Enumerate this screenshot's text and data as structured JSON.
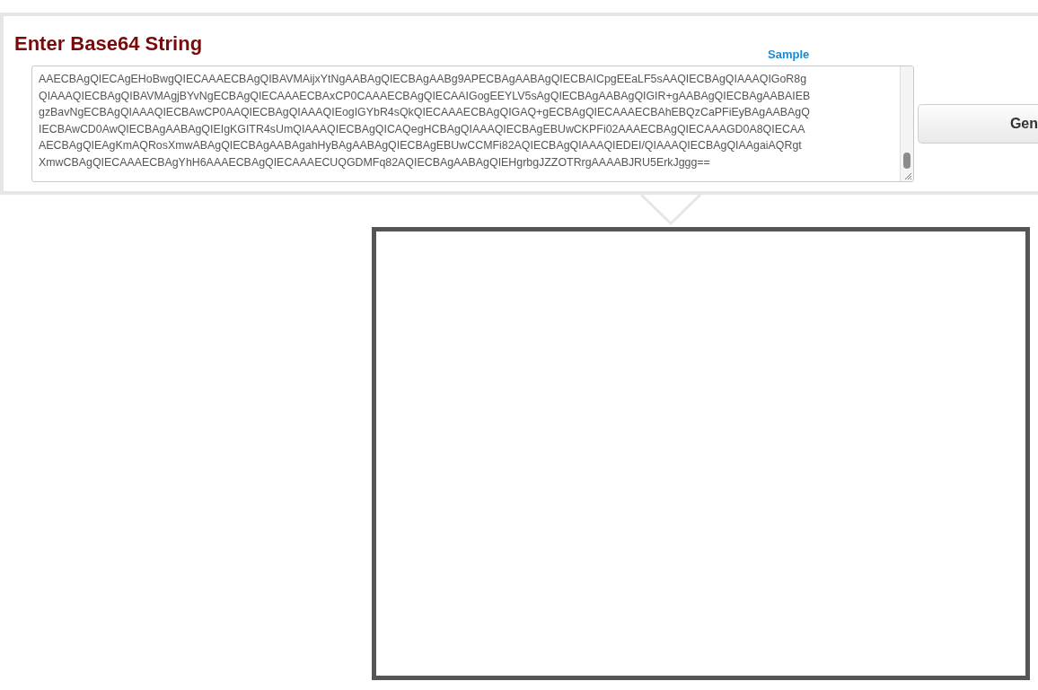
{
  "title": "Enter Base64 String",
  "sample_link": "Sample",
  "input": {
    "lines": [
      "AAECBAgQIECAgEHoBwgQIECAAAECBAgQIBAVMAijxYtNgAABAgQIECBAgAABg9APECBAgAABAgQIECBAICpgEEaLF5sAAQIECBAgQIAAAQIGoR8g",
      "QIAAAQIECBAgQIBAVMAgjBYvNgECBAgQIECAAAECBAxCP0CAAAECBAgQIECAAIGogEEYLV5sAgQIECBAgAABAgQIGIR+gAABAgQIECBAgAABAIEB",
      "gzBavNgECBAgQIAAAQIECBAwCP0AAQIECBAgQIAAAQIEogIGYbR4sQkQIECAAAECBAgQIGAQ+gECBAgQIECAAAECBAhEBQzCaPFiEyBAgAABAgQ",
      "IECBAwCD0AwQIECBAgAABAgQIEIgKGITR4sUmQIAAAQIECBAgQICAQegHCBAgQIAAAQIECBAgEBUwCKPFi02AAAECBAgQIECAAAGD0A8QIECAA",
      "AECBAgQIEAgKmAQRosXmwABAgQIECBAgAABAgahHyBAgAABAgQIECBAgEBUwCCMFi82AQIECBAgQIAAAQIEDEI/QIAAAQIECBAgQIAAgaiAQRgt",
      "XmwCBAgQIECAAAECBAgYhH6AAAECBAgQIECAAAECUQGDMFq82AQIECBAgAABAgQIEHgrbgJZZOTRrgAAAABJRU5ErkJggg=="
    ]
  },
  "button": {
    "label": "Gen"
  }
}
